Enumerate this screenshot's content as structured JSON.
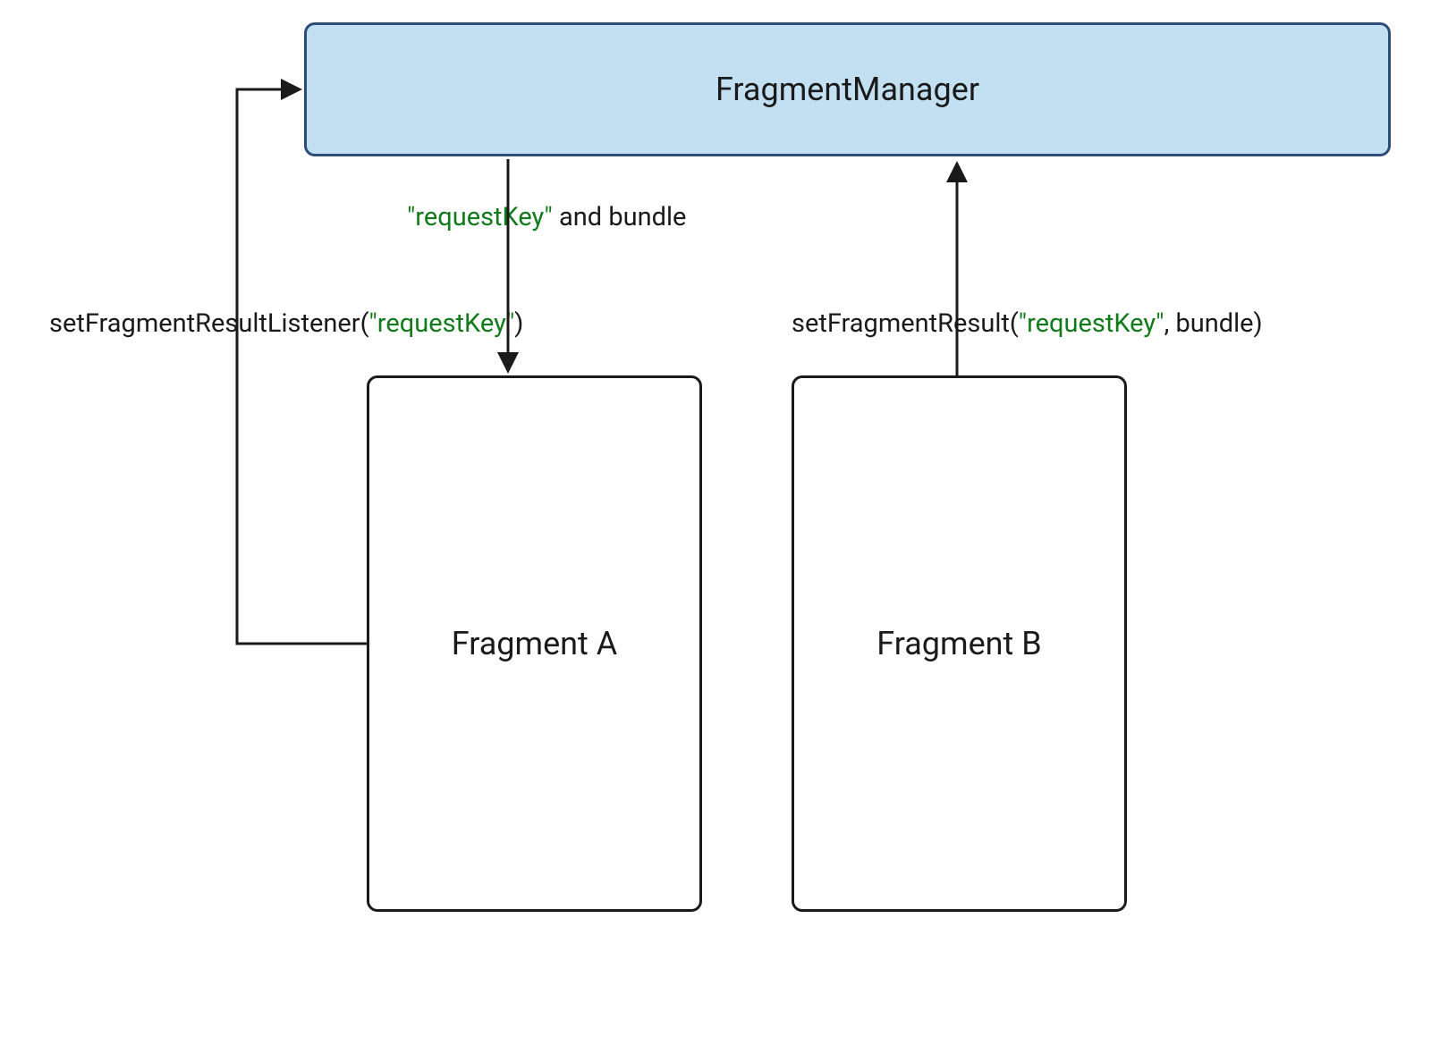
{
  "boxes": {
    "manager": "FragmentManager",
    "fragmentA": "Fragment A",
    "fragmentB": "Fragment B"
  },
  "labels": {
    "listener_prefix": "setFragmentResultListener(",
    "listener_key": "\"requestKey\"",
    "listener_suffix": ")",
    "bundle_key": "\"requestKey\"",
    "bundle_suffix": " and bundle",
    "result_prefix": "setFragmentResult(",
    "result_key": "\"requestKey\"",
    "result_suffix": ", bundle)"
  }
}
